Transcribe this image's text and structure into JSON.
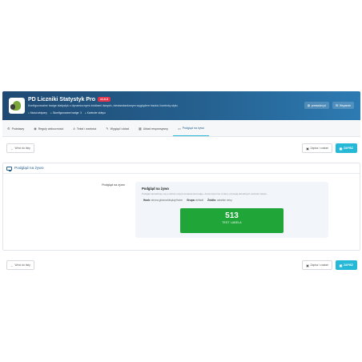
{
  "header": {
    "title": "PD Liczniki Statystyk Pro",
    "version": "v1.0.3",
    "description": "Konfigurowalne badge statystyk z dynamicznymi źródłami danych, niestandardowym wyglądem tracka i kontrolą stylu.",
    "stats": [
      "Moduł aktywny",
      "Skonfigurowane badge: 3",
      "Kontroler sklepu"
    ],
    "buttons": [
      "prestadev.pl",
      "Wsparcie"
    ]
  },
  "tabs": [
    {
      "label": "Podstawy",
      "icon": "gear-icon",
      "glyph": "⚙"
    },
    {
      "label": "Reguły widoczności",
      "icon": "eye-icon",
      "glyph": "◉"
    },
    {
      "label": "Tekst i wartości",
      "icon": "text-icon",
      "glyph": "A"
    },
    {
      "label": "Wygląd i układ",
      "icon": "brush-icon",
      "glyph": "✎"
    },
    {
      "label": "Układ responsywny",
      "icon": "grid-icon",
      "glyph": "▦"
    },
    {
      "label": "Podgląd na żywo",
      "icon": "monitor-icon",
      "glyph": "▭"
    }
  ],
  "active_tab": 5,
  "toolbar": {
    "back_label": "Wróć do listy",
    "save_stay_label": "Zapisz i zostań",
    "save_label": "ZAPISZ"
  },
  "panel": {
    "title": "Podgląd na żywo",
    "row_label": "Podgląd na żywo",
    "preview": {
      "title": "Podgląd na żywo",
      "description": "Podgląd aktualizuje się podczas edycji zestawienia badge. Automatycznie zmiany używają aktualnych wartości tekstu.",
      "hook_label": "Hook:",
      "hook_value": "strona główna/displayHome",
      "group_label": "Grupa:",
      "group_value": "default",
      "source_label": "Źródło:",
      "source_value": "ostatnie ceny",
      "counter_value": "513",
      "counter_label": "TEST LABELA"
    }
  },
  "colors": {
    "header": "#25608f",
    "accent": "#25b9d7",
    "counter": "#1fa538",
    "version_badge": "#e4344b"
  }
}
